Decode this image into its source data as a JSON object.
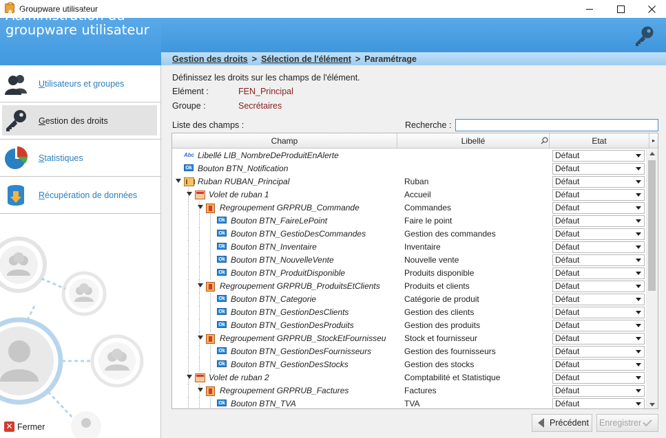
{
  "window": {
    "title": "Groupware utilisateur",
    "controls": [
      "minimize",
      "maximize",
      "close"
    ]
  },
  "header": {
    "title": "Administration du groupware utilisateur",
    "icon": "key-icon"
  },
  "breadcrumb": {
    "items": [
      "Gestion des droits",
      "Sélection de l'élément",
      "Paramétrage"
    ],
    "separator": ">"
  },
  "sidebar": {
    "items": [
      {
        "label": "Utilisateurs et groupes",
        "icon": "users-icon",
        "active": false
      },
      {
        "label": "Gestion des droits",
        "icon": "key-icon",
        "active": true
      },
      {
        "label": "Statistiques",
        "icon": "pie-chart-icon",
        "active": false
      },
      {
        "label": "Récupération de données",
        "icon": "database-download-icon",
        "active": false
      }
    ],
    "close_label": "Fermer"
  },
  "main": {
    "intro": "Définissez les droits sur les champs de l'élément.",
    "element_label": "Elément :",
    "element_value": "FEN_Principal",
    "group_label": "Groupe :",
    "group_value": "Secrétaires",
    "list_label": "Liste des champs :",
    "search_label": "Recherche :",
    "search_value": ""
  },
  "grid": {
    "columns": [
      "Champ",
      "Libellé",
      "Etat"
    ],
    "rows": [
      {
        "champ": "Libellé LIB_NombreDeProduitEnAlerte",
        "libelle": "",
        "etat": "Défaut",
        "icon": "abc",
        "level": 0,
        "expandable": false
      },
      {
        "champ": "Bouton BTN_Notification",
        "libelle": "",
        "etat": "Défaut",
        "icon": "ok",
        "level": 0,
        "expandable": false
      },
      {
        "champ": "Ruban RUBAN_Principal",
        "libelle": "Ruban",
        "etat": "Défaut",
        "icon": "ribbon",
        "level": 0,
        "expandable": true
      },
      {
        "champ": "Volet de ruban 1",
        "libelle": "Accueil",
        "etat": "Défaut",
        "icon": "panel",
        "level": 1,
        "expandable": true
      },
      {
        "champ": "Regroupement GRPRUB_Commande",
        "libelle": "Commandes",
        "etat": "Défaut",
        "icon": "group",
        "level": 2,
        "expandable": true
      },
      {
        "champ": "Bouton BTN_FaireLePoint",
        "libelle": "Faire le point",
        "etat": "Défaut",
        "icon": "ok",
        "level": 3,
        "expandable": false
      },
      {
        "champ": "Bouton BTN_GestioDesCommandes",
        "libelle": "Gestion des commandes",
        "etat": "Défaut",
        "icon": "ok",
        "level": 3,
        "expandable": false
      },
      {
        "champ": "Bouton BTN_Inventaire",
        "libelle": "Inventaire",
        "etat": "Défaut",
        "icon": "ok",
        "level": 3,
        "expandable": false
      },
      {
        "champ": "Bouton BTN_NouvelleVente",
        "libelle": "Nouvelle vente",
        "etat": "Défaut",
        "icon": "ok",
        "level": 3,
        "expandable": false
      },
      {
        "champ": "Bouton BTN_ProduitDisponible",
        "libelle": "Produits disponible",
        "etat": "Défaut",
        "icon": "ok",
        "level": 3,
        "expandable": false
      },
      {
        "champ": "Regroupement GRPRUB_ProduitsEtClients",
        "libelle": "Produits et clients",
        "etat": "Défaut",
        "icon": "group",
        "level": 2,
        "expandable": true
      },
      {
        "champ": "Bouton BTN_Categorie",
        "libelle": "Catégorie de produit",
        "etat": "Défaut",
        "icon": "ok",
        "level": 3,
        "expandable": false
      },
      {
        "champ": "Bouton BTN_GestionDesClients",
        "libelle": "Gestion des clients",
        "etat": "Défaut",
        "icon": "ok",
        "level": 3,
        "expandable": false
      },
      {
        "champ": "Bouton BTN_GestionDesProduits",
        "libelle": "Gestion des produits",
        "etat": "Défaut",
        "icon": "ok",
        "level": 3,
        "expandable": false
      },
      {
        "champ": "Regroupement GRPRUB_StockEtFournisseu",
        "libelle": "Stock et fournisseur",
        "etat": "Défaut",
        "icon": "group",
        "level": 2,
        "expandable": true
      },
      {
        "champ": "Bouton BTN_GestionDesFournisseurs",
        "libelle": "Gestion des fournisseurs",
        "etat": "Défaut",
        "icon": "ok",
        "level": 3,
        "expandable": false
      },
      {
        "champ": "Bouton BTN_GestionDesStocks",
        "libelle": "Gestion des stocks",
        "etat": "Défaut",
        "icon": "ok",
        "level": 3,
        "expandable": false
      },
      {
        "champ": "Volet de ruban 2",
        "libelle": "Comptabilité et Statistique",
        "etat": "Défaut",
        "icon": "panel",
        "level": 1,
        "expandable": true
      },
      {
        "champ": "Regroupement GRPRUB_Factures",
        "libelle": "Factures",
        "etat": "Défaut",
        "icon": "group",
        "level": 2,
        "expandable": true
      },
      {
        "champ": "Bouton BTN_TVA",
        "libelle": "TVA",
        "etat": "Défaut",
        "icon": "ok",
        "level": 3,
        "expandable": false
      }
    ]
  },
  "buttons": {
    "previous": "Précédent",
    "save": "Enregistrer",
    "save_enabled": false
  },
  "colors": {
    "accent": "#4199df",
    "breadcrumb_bg": "#a9d3f1",
    "value_red": "#8a1c1c",
    "link_blue": "#2a7fc1"
  }
}
